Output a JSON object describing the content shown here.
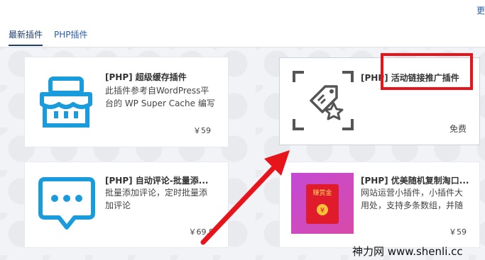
{
  "header": {
    "more_label": "更",
    "tabs": [
      "最新插件",
      "PHP插件"
    ]
  },
  "cards": [
    {
      "title": "[PHP] 超级缓存插件",
      "desc_line1": "此插件参考自WordPress平",
      "desc_line2": "台的 WP Super Cache 编写",
      "price": "￥59",
      "icon": "shop-icon"
    },
    {
      "title": "[PHP] 活动链接推广插件",
      "price": "免费",
      "icon": "tag-star-icon"
    },
    {
      "title": "[PHP] 自动评论-批量添...",
      "desc_line1": "批量添加评论，定时批量添",
      "desc_line2": "加评论",
      "price": "￥69.9",
      "icon": "chat-bubble-icon"
    },
    {
      "title": "[PHP] 优美随机复制淘口...",
      "desc_line1": "网站运营小插件，小插件大",
      "desc_line2": "用处，支持多条数组，并随",
      "price": "￥59",
      "icon": "red-envelope-icon",
      "envelope_text": "赚赏金"
    }
  ],
  "watermark": "神力网 www.shenli.cc",
  "colors": {
    "accent_blue": "#1a9bdc",
    "highlight_red": "#e8141c"
  }
}
